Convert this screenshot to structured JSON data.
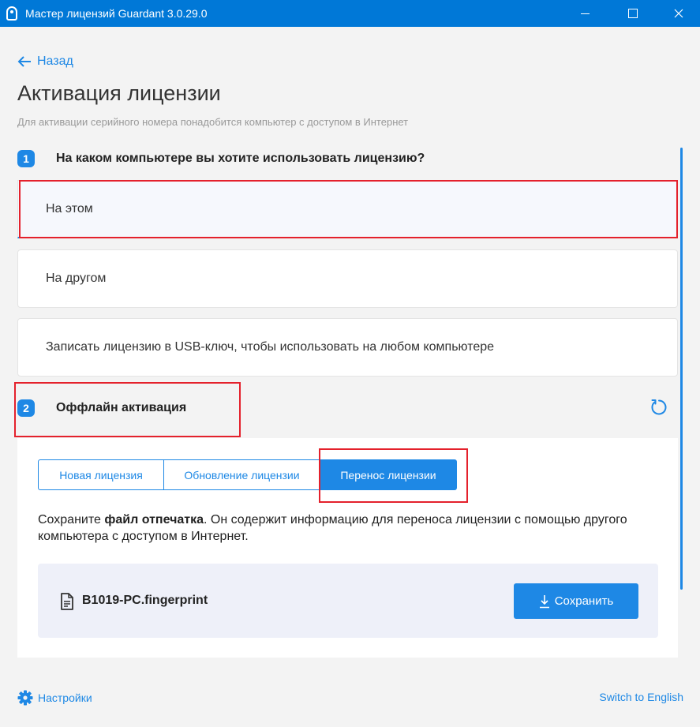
{
  "window": {
    "title": "Мастер лицензий Guardant 3.0.29.0",
    "icons": {
      "app": "guardant-key-icon",
      "minimize": "minimize-icon",
      "maximize": "maximize-icon",
      "close": "close-icon"
    }
  },
  "nav": {
    "back_label": "Назад",
    "back_icon": "arrow-left-icon"
  },
  "page": {
    "title": "Активация лицензии",
    "subtitle": "Для активации серийного номера понадобится компьютер с доступом в Интернет"
  },
  "step1": {
    "number": "1",
    "title": "На каком компьютере вы хотите использовать лицензию?",
    "options": [
      {
        "label": "На этом",
        "selected": true
      },
      {
        "label": "На другом",
        "selected": false
      },
      {
        "label": "Записать лицензию в USB-ключ, чтобы использовать на любом компьютере",
        "selected": false
      }
    ]
  },
  "step2": {
    "number": "2",
    "title": "Оффлайн активация",
    "refresh_icon": "refresh-icon",
    "tabs": [
      {
        "label": "Новая лицензия",
        "active": false
      },
      {
        "label": "Обновление лицензии",
        "active": false
      },
      {
        "label": "Перенос лицензии",
        "active": true
      }
    ],
    "desc_prefix": "Сохраните ",
    "desc_bold": "файл отпечатка",
    "desc_suffix": ". Он содержит информацию для переноса лицензии с помощью другого компьютера с доступом в Интернет.",
    "file": {
      "name": "B1019-PC.fingerprint",
      "icon": "file-document-icon"
    },
    "save_label": "Сохранить",
    "save_icon": "download-icon"
  },
  "footer": {
    "settings_label": "Настройки",
    "settings_icon": "gear-icon",
    "language_label": "Switch to English"
  },
  "colors": {
    "accent": "#1e88e5",
    "titlebar": "#0078d7",
    "highlight": "#e4212c"
  }
}
